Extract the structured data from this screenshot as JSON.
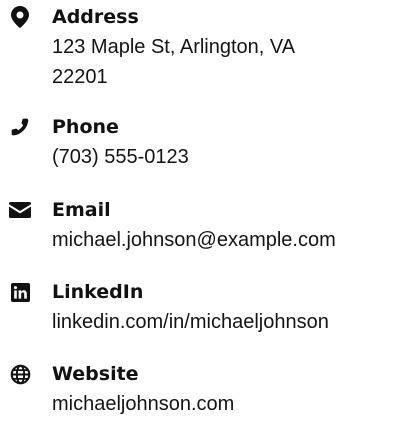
{
  "contacts": {
    "address": {
      "icon": "map-marker-icon",
      "label": "Address",
      "value": "123 Maple St, Arlington, VA 22201"
    },
    "phone": {
      "icon": "phone-icon",
      "label": "Phone",
      "value": "(703) 555-0123"
    },
    "email": {
      "icon": "envelope-icon",
      "label": "Email",
      "value": "michael.johnson@example.com"
    },
    "linkedin": {
      "icon": "linkedin-icon",
      "label": "LinkedIn",
      "value": "linkedin.com/in/michaeljohnson"
    },
    "website": {
      "icon": "globe-icon",
      "label": "Website",
      "value": "michaeljohnson.com"
    }
  },
  "colors": {
    "text": "#111111",
    "icon": "#111111",
    "background": "#ffffff"
  }
}
